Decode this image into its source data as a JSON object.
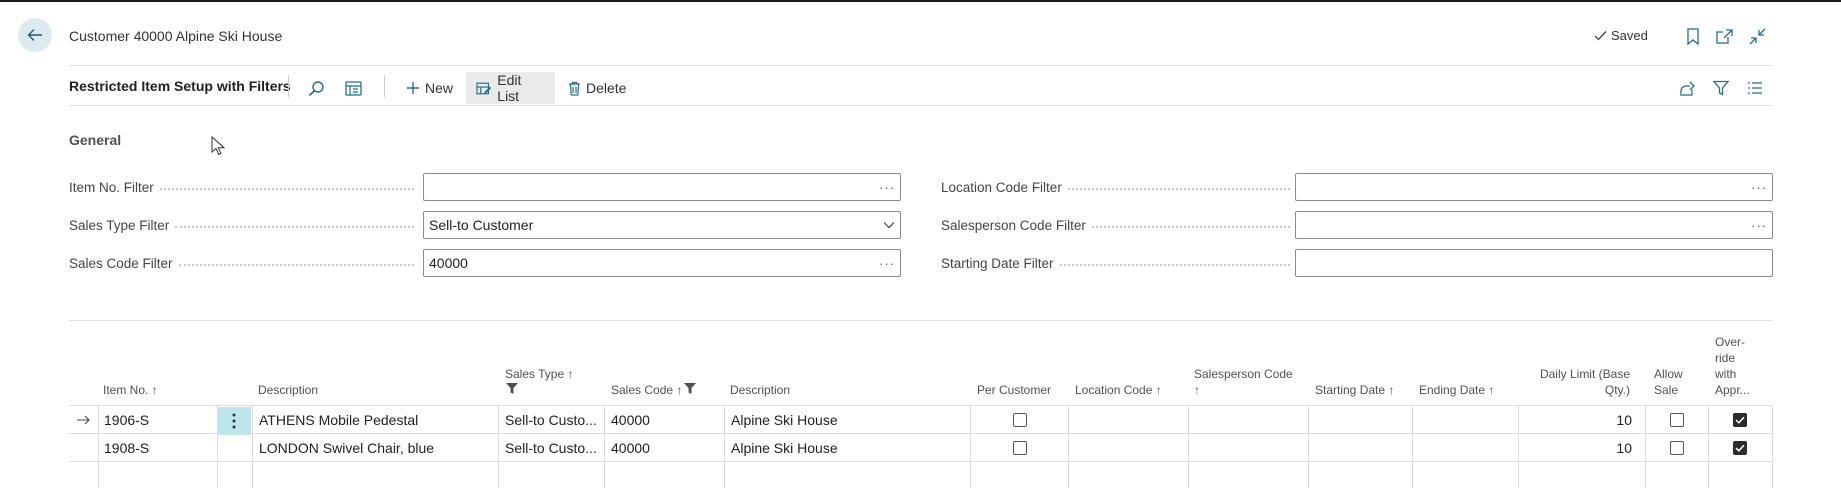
{
  "header": {
    "caption": "Customer 40000 Alpine Ski House",
    "saved": "Saved",
    "icons": [
      "back-arrow-icon",
      "bookmark-icon",
      "open-new-window-icon",
      "collapse-icon"
    ]
  },
  "action_bar": {
    "title": "Restricted Item Setup with Filters",
    "new_label": "New",
    "edit_list_label": "Edit List",
    "delete_label": "Delete"
  },
  "general": {
    "title": "General",
    "fields": {
      "item_no_filter": {
        "label": "Item No. Filter",
        "value": ""
      },
      "sales_type_filter": {
        "label": "Sales Type Filter",
        "value": "Sell-to Customer"
      },
      "sales_code_filter": {
        "label": "Sales Code Filter",
        "value": "40000"
      },
      "location_code_filter": {
        "label": "Location Code Filter",
        "value": ""
      },
      "salesperson_code_filter": {
        "label": "Salesperson Code Filter",
        "value": ""
      },
      "starting_date_filter": {
        "label": "Starting Date Filter",
        "value": ""
      }
    }
  },
  "grid": {
    "columns": {
      "item_no": "Item No. ↑",
      "description": "Description",
      "sales_type": "Sales Type ↑",
      "sales_code": "Sales Code ↑",
      "description2": "Description",
      "per_customer": "Per Customer",
      "location_code": "Location Code ↑",
      "salesperson_code_1": "Salesperson Code",
      "salesperson_code_2": "↑",
      "starting_date": "Starting Date ↑",
      "ending_date": "Ending Date ↑",
      "daily_limit_1": "Daily Limit (Base",
      "daily_limit_2": "Qty.)",
      "allow_sale_1": "Allow",
      "allow_sale_2": "Sale",
      "override_1": "Over-",
      "override_2": "ride",
      "override_3": "with",
      "override_4": "Appr..."
    },
    "rows": [
      {
        "item_no": "1906-S",
        "description": "ATHENS Mobile Pedestal",
        "sales_type": "Sell-to Custo...",
        "sales_code": "40000",
        "description2": "Alpine Ski House",
        "per_customer": false,
        "daily_limit": "10",
        "allow_sale": false,
        "override": true
      },
      {
        "item_no": "1908-S",
        "description": "LONDON Swivel Chair, blue",
        "sales_type": "Sell-to Custo...",
        "sales_code": "40000",
        "description2": "Alpine Ski House",
        "per_customer": false,
        "daily_limit": "10",
        "allow_sale": false,
        "override": true
      }
    ]
  }
}
